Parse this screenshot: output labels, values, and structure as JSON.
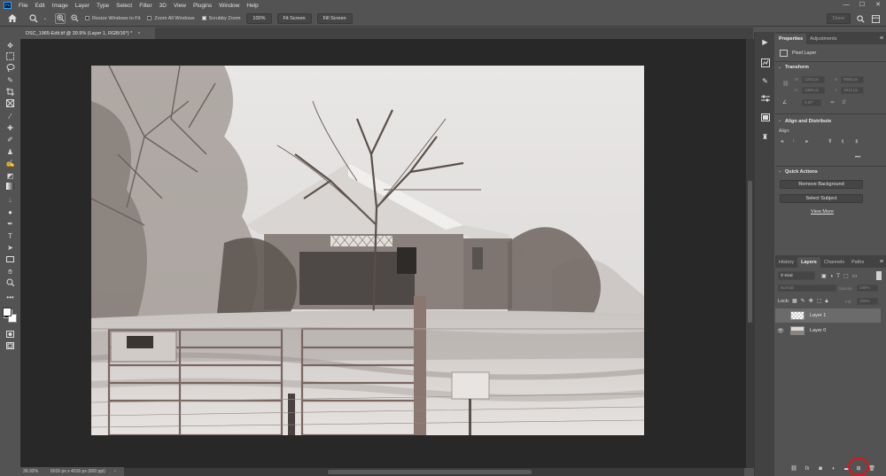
{
  "app": {
    "logo_text": "Ps"
  },
  "menu": [
    "File",
    "Edit",
    "Image",
    "Layer",
    "Type",
    "Select",
    "Filter",
    "3D",
    "View",
    "Plugins",
    "Window",
    "Help"
  ],
  "window_controls": {
    "minimize": "—",
    "maximize": "☐",
    "close": "✕"
  },
  "options_bar": {
    "resize_windows_label": "Resize Windows to Fit",
    "zoom_all_label": "Zoom All Windows",
    "scrubby_zoom_label": "Scrubby Zoom",
    "zoom_100": "100%",
    "fit_screen": "Fit Screen",
    "fill_screen": "Fill Screen",
    "done": "Done"
  },
  "document_tab": {
    "title": "DSC_1965-Edit.tif @ 39.9% (Layer 1, RGB/16*) *",
    "close": "×"
  },
  "status_bar": {
    "zoom": "39.92%",
    "info": "6016 px x 4016 px (600 ppi)",
    "arrow": "›"
  },
  "properties_panel": {
    "tabs": [
      "Properties",
      "Adjustments"
    ],
    "kind": "Pixel Layer",
    "transform_title": "Transform",
    "transform_fields": {
      "w_label": "W",
      "w": "1203 px",
      "x_label": "X",
      "x": "0000 px",
      "h_label": "H",
      "h": "1369 px",
      "y_label": "Y",
      "y": "1812 px",
      "angle": "0.00°"
    },
    "align_title": "Align and Distribute",
    "align_label": "Align:",
    "more": "•••",
    "quick_actions_title": "Quick Actions",
    "remove_bg": "Remove Background",
    "select_subject": "Select Subject",
    "view_more": "View More"
  },
  "layers_panel": {
    "tabs": [
      "History",
      "Layers",
      "Channels",
      "Paths"
    ],
    "kind_filter": "Kind",
    "blend_mode": "Normal",
    "opacity_label": "Opacity:",
    "opacity": "100%",
    "lock_label": "Lock:",
    "fill_label": "Fill:",
    "fill": "100%",
    "layers": [
      {
        "name": "Layer 1",
        "visible": false,
        "selected": true
      },
      {
        "name": "Layer 0",
        "visible": true,
        "selected": false
      }
    ]
  },
  "colors": {
    "accent_highlight": "#e0121c",
    "panel_bg": "#535353",
    "dark_bg": "#282828"
  }
}
